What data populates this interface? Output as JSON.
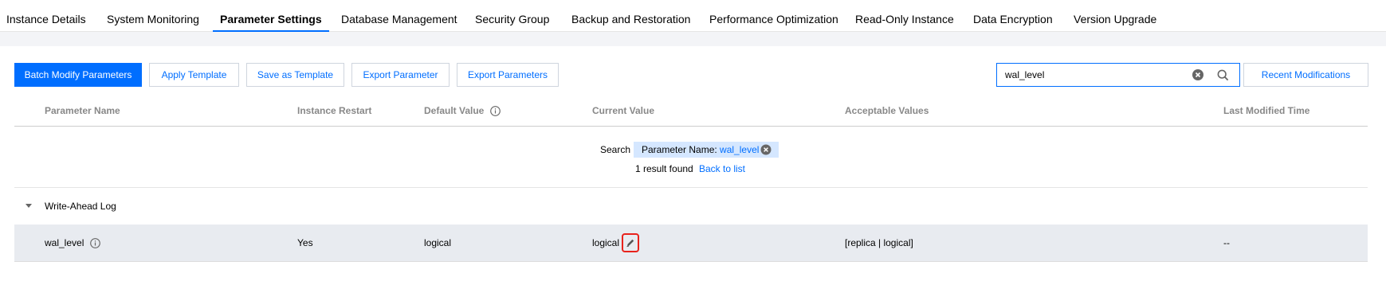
{
  "tabs": [
    {
      "label": "Instance Details"
    },
    {
      "label": "System Monitoring"
    },
    {
      "label": "Parameter Settings"
    },
    {
      "label": "Database Management"
    },
    {
      "label": "Security Group"
    },
    {
      "label": "Backup and Restoration"
    },
    {
      "label": "Performance Optimization"
    },
    {
      "label": "Read-Only Instance"
    },
    {
      "label": "Data Encryption"
    },
    {
      "label": "Version Upgrade"
    }
  ],
  "active_tab": "Parameter Settings",
  "toolbar": {
    "batch_modify": "Batch Modify Parameters",
    "apply_template": "Apply Template",
    "save_template": "Save as Template",
    "export_parameter": "Export Parameter",
    "export_parameters": "Export Parameters",
    "recent_modifications": "Recent Modifications"
  },
  "search": {
    "value": "wal_level",
    "clear_icon": "clear-circle-icon",
    "search_icon": "magnifier-icon"
  },
  "table": {
    "columns": {
      "name": "Parameter Name",
      "restart": "Instance Restart",
      "default": "Default Value",
      "current": "Current Value",
      "acceptable": "Acceptable Values",
      "modified": "Last Modified Time"
    }
  },
  "filter": {
    "label": "Search",
    "tag_key": "Parameter Name: ",
    "tag_value": "wal_level",
    "result_text": "1 result found",
    "back_link": "Back to list"
  },
  "group": {
    "label": "Write-Ahead Log"
  },
  "row": {
    "name": "wal_level",
    "restart": "Yes",
    "default": "logical",
    "current": "logical",
    "acceptable": "[replica | logical]",
    "modified": "--"
  },
  "colors": {
    "accent": "#006eff",
    "highlight_border": "#e8221c",
    "row_bg": "#e8ebf0",
    "tag_bg": "#d5e7ff"
  }
}
